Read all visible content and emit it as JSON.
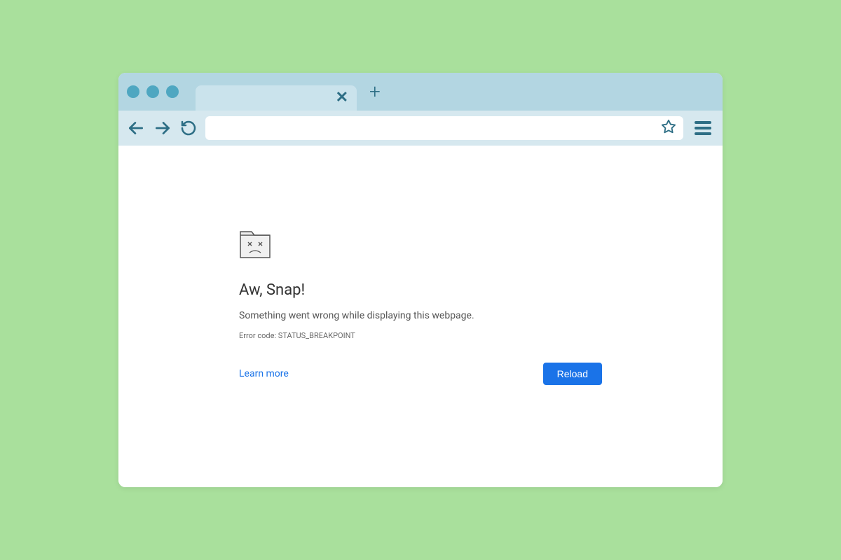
{
  "error": {
    "title": "Aw, Snap!",
    "message": "Something went wrong while displaying this webpage.",
    "code": "Error code: STATUS_BREAKPOINT",
    "learn_more_label": "Learn more",
    "reload_label": "Reload"
  },
  "address_bar": {
    "value": ""
  }
}
